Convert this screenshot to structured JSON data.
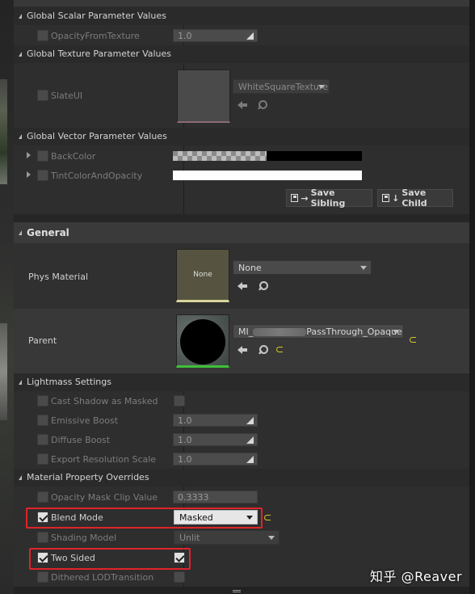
{
  "sections": {
    "global_scalar": "Global Scalar Parameter Values",
    "global_texture": "Global Texture Parameter Values",
    "global_vector": "Global Vector Parameter Values",
    "general": "General",
    "lightmass": "Lightmass Settings",
    "material_overrides": "Material Property Overrides"
  },
  "scalar": {
    "opacity_from_texture": {
      "label": "OpacityFromTexture",
      "value": "1.0"
    }
  },
  "texture": {
    "slate_ui": {
      "label": "SlateUI",
      "value": "WhiteSquareTexture"
    }
  },
  "vector": {
    "back_color": {
      "label": "BackColor"
    },
    "tint_color": {
      "label": "TintColorAndOpacity"
    }
  },
  "buttons": {
    "save_sibling": "Save Sibling",
    "save_child": "Save Child"
  },
  "general": {
    "phys_material": {
      "label": "Phys Material",
      "thumb": "None",
      "value": "None"
    },
    "parent": {
      "label": "Parent",
      "value_prefix": "MI_",
      "value_suffix": "PassThrough_Opaque"
    }
  },
  "lightmass": {
    "cast_shadow_as_masked": {
      "label": "Cast Shadow as Masked"
    },
    "emissive_boost": {
      "label": "Emissive Boost",
      "value": "1.0"
    },
    "diffuse_boost": {
      "label": "Diffuse Boost",
      "value": "1.0"
    },
    "export_resolution_scale": {
      "label": "Export Resolution Scale",
      "value": "1.0"
    }
  },
  "overrides": {
    "opacity_mask_clip_value": {
      "label": "Opacity Mask Clip Value",
      "value": "0.3333"
    },
    "blend_mode": {
      "label": "Blend Mode",
      "value": "Masked",
      "checked": true
    },
    "shading_model": {
      "label": "Shading Model",
      "value": "Unlit"
    },
    "two_sided": {
      "label": "Two Sided",
      "checked": true
    },
    "dithered_lod": {
      "label": "Dithered LODTransition"
    }
  },
  "watermark": "知乎 @Reaver",
  "colors": {
    "highlight": "#e0232a",
    "reset_arrow": "#d6c22a",
    "panel_bg": "#2e2e2e"
  }
}
